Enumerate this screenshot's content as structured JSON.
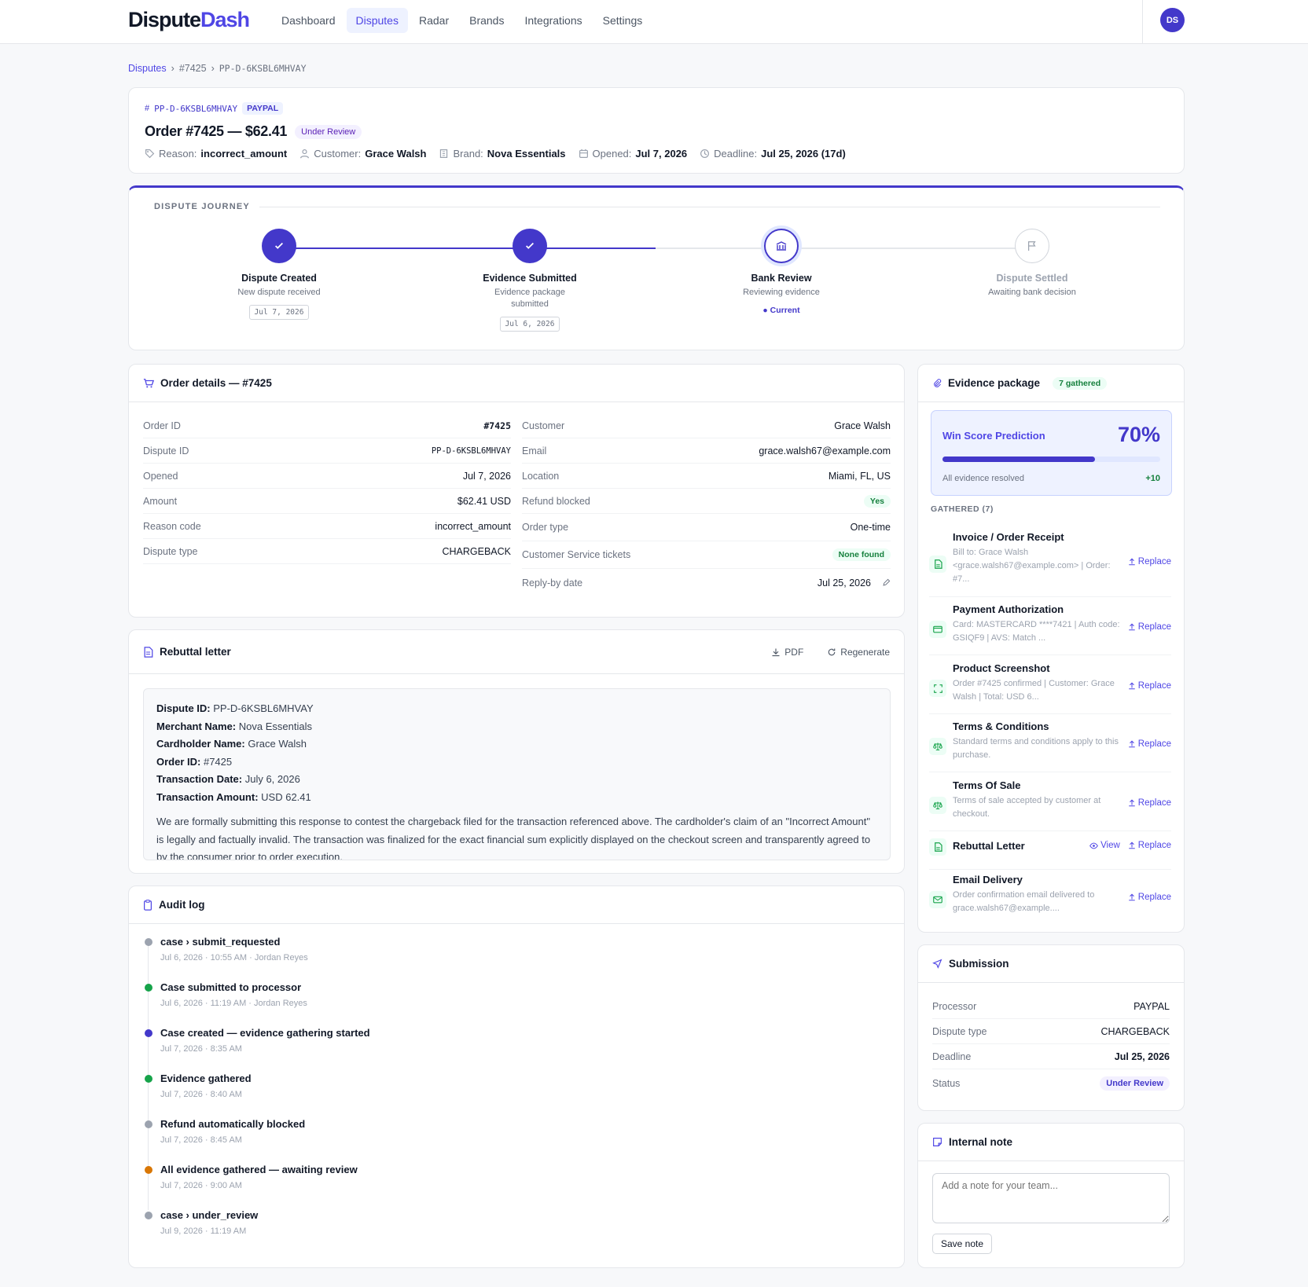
{
  "app": {
    "logo_part1": "Dispute",
    "logo_part2": "Dash",
    "avatar": "DS"
  },
  "nav": [
    "Dashboard",
    "Disputes",
    "Radar",
    "Brands",
    "Integrations",
    "Settings"
  ],
  "nav_active": "Disputes",
  "breadcrumb": {
    "root": "Disputes",
    "order": "#7425",
    "dispute": "PP-D-6KSBL6MHVAY"
  },
  "header": {
    "dispute_id": "PP-D-6KSBL6MHVAY",
    "processor": "PAYPAL",
    "title": "Order #7425 — $62.41",
    "status": "Under Review",
    "reason_label": "Reason:",
    "reason": "incorrect_amount",
    "customer_label": "Customer:",
    "customer": "Grace Walsh",
    "brand_label": "Brand:",
    "brand": "Nova Essentials",
    "opened_label": "Opened:",
    "opened": "Jul 7, 2026",
    "deadline_label": "Deadline:",
    "deadline": "Jul 25, 2026 (17d)"
  },
  "journey": {
    "title": "DISPUTE JOURNEY",
    "progress_fraction": 0.5,
    "steps": [
      {
        "title": "Dispute Created",
        "sub": "New dispute received",
        "date": "Jul 7, 2026",
        "state": "done"
      },
      {
        "title": "Evidence Submitted",
        "sub": "Evidence package submitted",
        "date": "Jul 6, 2026",
        "state": "done"
      },
      {
        "title": "Bank Review",
        "sub": "Reviewing evidence",
        "current_label": "Current",
        "state": "current"
      },
      {
        "title": "Dispute Settled",
        "sub": "Awaiting bank decision",
        "state": "pending"
      }
    ]
  },
  "order": {
    "title": "Order details — #7425",
    "left": [
      {
        "k": "Order ID",
        "v": "#7425"
      },
      {
        "k": "Dispute ID",
        "v": "PP-D-6KSBL6MHVAY"
      },
      {
        "k": "Opened",
        "v": "Jul 7, 2026"
      },
      {
        "k": "Amount",
        "v": "$62.41 USD"
      },
      {
        "k": "Reason code",
        "v": "incorrect_amount"
      },
      {
        "k": "Dispute type",
        "v": "CHARGEBACK"
      }
    ],
    "right": [
      {
        "k": "Customer",
        "v": "Grace Walsh"
      },
      {
        "k": "Email",
        "v": "grace.walsh67@example.com"
      },
      {
        "k": "Location",
        "v": "Miami, FL, US"
      },
      {
        "k": "Refund blocked",
        "v": "Yes"
      },
      {
        "k": "Order type",
        "v": "One-time"
      },
      {
        "k": "Customer Service tickets",
        "v": "None found"
      },
      {
        "k": "Reply-by date",
        "v": "Jul 25, 2026"
      }
    ]
  },
  "rebuttal": {
    "title": "Rebuttal letter",
    "pdf": "PDF",
    "regenerate": "Regenerate",
    "fields": [
      {
        "k": "Dispute ID:",
        "v": "PP-D-6KSBL6MHVAY"
      },
      {
        "k": "Merchant Name:",
        "v": "Nova Essentials"
      },
      {
        "k": "Cardholder Name:",
        "v": "Grace Walsh"
      },
      {
        "k": "Order ID:",
        "v": "#7425"
      },
      {
        "k": "Transaction Date:",
        "v": "July 6, 2026"
      },
      {
        "k": "Transaction Amount:",
        "v": "USD 62.41"
      }
    ],
    "body": "We are formally submitting this response to contest the chargeback filed for the transaction referenced above. The cardholder's claim of an \"Incorrect Amount\" is legally and factually invalid. The transaction was finalized for the exact financial sum explicitly displayed on the checkout screen and transparently agreed to by the consumer prior to order execution."
  },
  "audit": {
    "title": "Audit log",
    "items": [
      {
        "t": "case › submit_requested",
        "s": "Jul 6, 2026 · 10:55 AM · Jordan Reyes",
        "color": "#9ca3af"
      },
      {
        "t": "Case submitted to processor",
        "s": "Jul 6, 2026 · 11:19 AM · Jordan Reyes",
        "color": "#16a34a"
      },
      {
        "t": "Case created — evidence gathering started",
        "s": "Jul 7, 2026 · 8:35 AM",
        "color": "#4338ca"
      },
      {
        "t": "Evidence gathered",
        "s": "Jul 7, 2026 · 8:40 AM",
        "color": "#16a34a"
      },
      {
        "t": "Refund automatically blocked",
        "s": "Jul 7, 2026 · 8:45 AM",
        "color": "#9ca3af"
      },
      {
        "t": "All evidence gathered — awaiting review",
        "s": "Jul 7, 2026 · 9:00 AM",
        "color": "#d97706"
      },
      {
        "t": "case › under_review",
        "s": "Jul 9, 2026 · 11:19 AM",
        "color": "#9ca3af"
      }
    ]
  },
  "evidence": {
    "title": "Evidence package",
    "badge": "7 gathered",
    "win_label": "Win Score Prediction",
    "win_score": "70%",
    "win_fraction": 0.7,
    "win_note": "All evidence resolved",
    "win_delta": "+10",
    "gathered_label": "GATHERED (7)",
    "view_label": "View",
    "replace_label": "Replace",
    "items": [
      {
        "t": "Invoice / Order Receipt",
        "s": "Bill to: Grace Walsh <grace.walsh67@example.com> | Order: #7...",
        "icon": "file-icon"
      },
      {
        "t": "Payment Authorization",
        "s": "Card: MASTERCARD ****7421 | Auth code: GSIQF9 | AVS: Match ...",
        "icon": "credit-card-icon"
      },
      {
        "t": "Product Screenshot",
        "s": "Order #7425 confirmed | Customer: Grace Walsh | Total: USD 6...",
        "icon": "screenshot-icon"
      },
      {
        "t": "Terms & Conditions",
        "s": "Standard terms and conditions apply to this purchase.",
        "icon": "scale-icon"
      },
      {
        "t": "Terms Of Sale",
        "s": "Terms of sale accepted by customer at checkout.",
        "icon": "scale-icon"
      },
      {
        "t": "Rebuttal Letter",
        "s": "",
        "icon": "file-icon",
        "has_view": true
      },
      {
        "t": "Email Delivery",
        "s": "Order confirmation email delivered to grace.walsh67@example....",
        "icon": "mail-icon"
      }
    ]
  },
  "submission": {
    "title": "Submission",
    "rows": [
      {
        "k": "Processor",
        "v": "PAYPAL"
      },
      {
        "k": "Dispute type",
        "v": "CHARGEBACK"
      },
      {
        "k": "Deadline",
        "v": "Jul 25, 2026"
      },
      {
        "k": "Status",
        "v": "Under Review"
      }
    ]
  },
  "note": {
    "title": "Internal note",
    "placeholder": "Add a note for your team...",
    "save": "Save note"
  },
  "colors": {
    "accent": "#4f46e5",
    "accent_dark": "#4338ca",
    "success": "#16a34a",
    "warning": "#d97706"
  }
}
